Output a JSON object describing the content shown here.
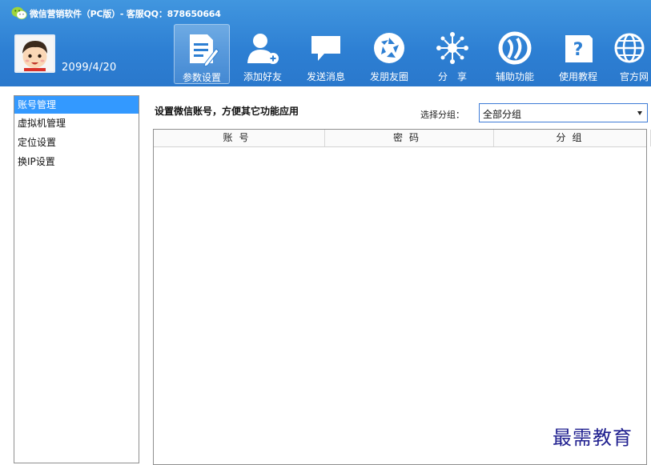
{
  "app": {
    "title": "微信营销软件（PC版）- 客服QQ：878650664",
    "logo_icon": "wechat-logo-icon"
  },
  "profile": {
    "date": "2099/4/20",
    "avatar_icon": "cartoon-boy-avatar"
  },
  "toolbar": {
    "items": [
      {
        "label": "参数设置",
        "icon": "edit-document-icon",
        "active": true
      },
      {
        "label": "添加好友",
        "icon": "add-user-icon",
        "active": false
      },
      {
        "label": "发送消息",
        "icon": "chat-bubble-icon",
        "active": false
      },
      {
        "label": "发朋友圈",
        "icon": "aperture-icon",
        "active": false
      },
      {
        "label": "分　享",
        "icon": "share-burst-icon",
        "active": false
      },
      {
        "label": "辅助功能",
        "icon": "helper-circle-icon",
        "active": false
      },
      {
        "label": "使用教程",
        "icon": "help-question-icon",
        "active": false
      },
      {
        "label": "官方网",
        "icon": "globe-icon",
        "active": false
      }
    ]
  },
  "sidebar": {
    "items": [
      {
        "label": "账号管理",
        "selected": true
      },
      {
        "label": "虚拟机管理",
        "selected": false
      },
      {
        "label": "定位设置",
        "selected": false
      },
      {
        "label": "换IP设置",
        "selected": false
      }
    ]
  },
  "main": {
    "title": "设置微信账号，方便其它功能应用",
    "group_label": "选择分组：",
    "group_select_value": "全部分组"
  },
  "table": {
    "columns": [
      "账号",
      "密码",
      "分组"
    ],
    "rows": []
  },
  "watermark": "最需教育",
  "colors": {
    "header_blue": "#2d7fd3",
    "selected_blue": "#3399ff",
    "select_border": "#3d7bd6"
  }
}
